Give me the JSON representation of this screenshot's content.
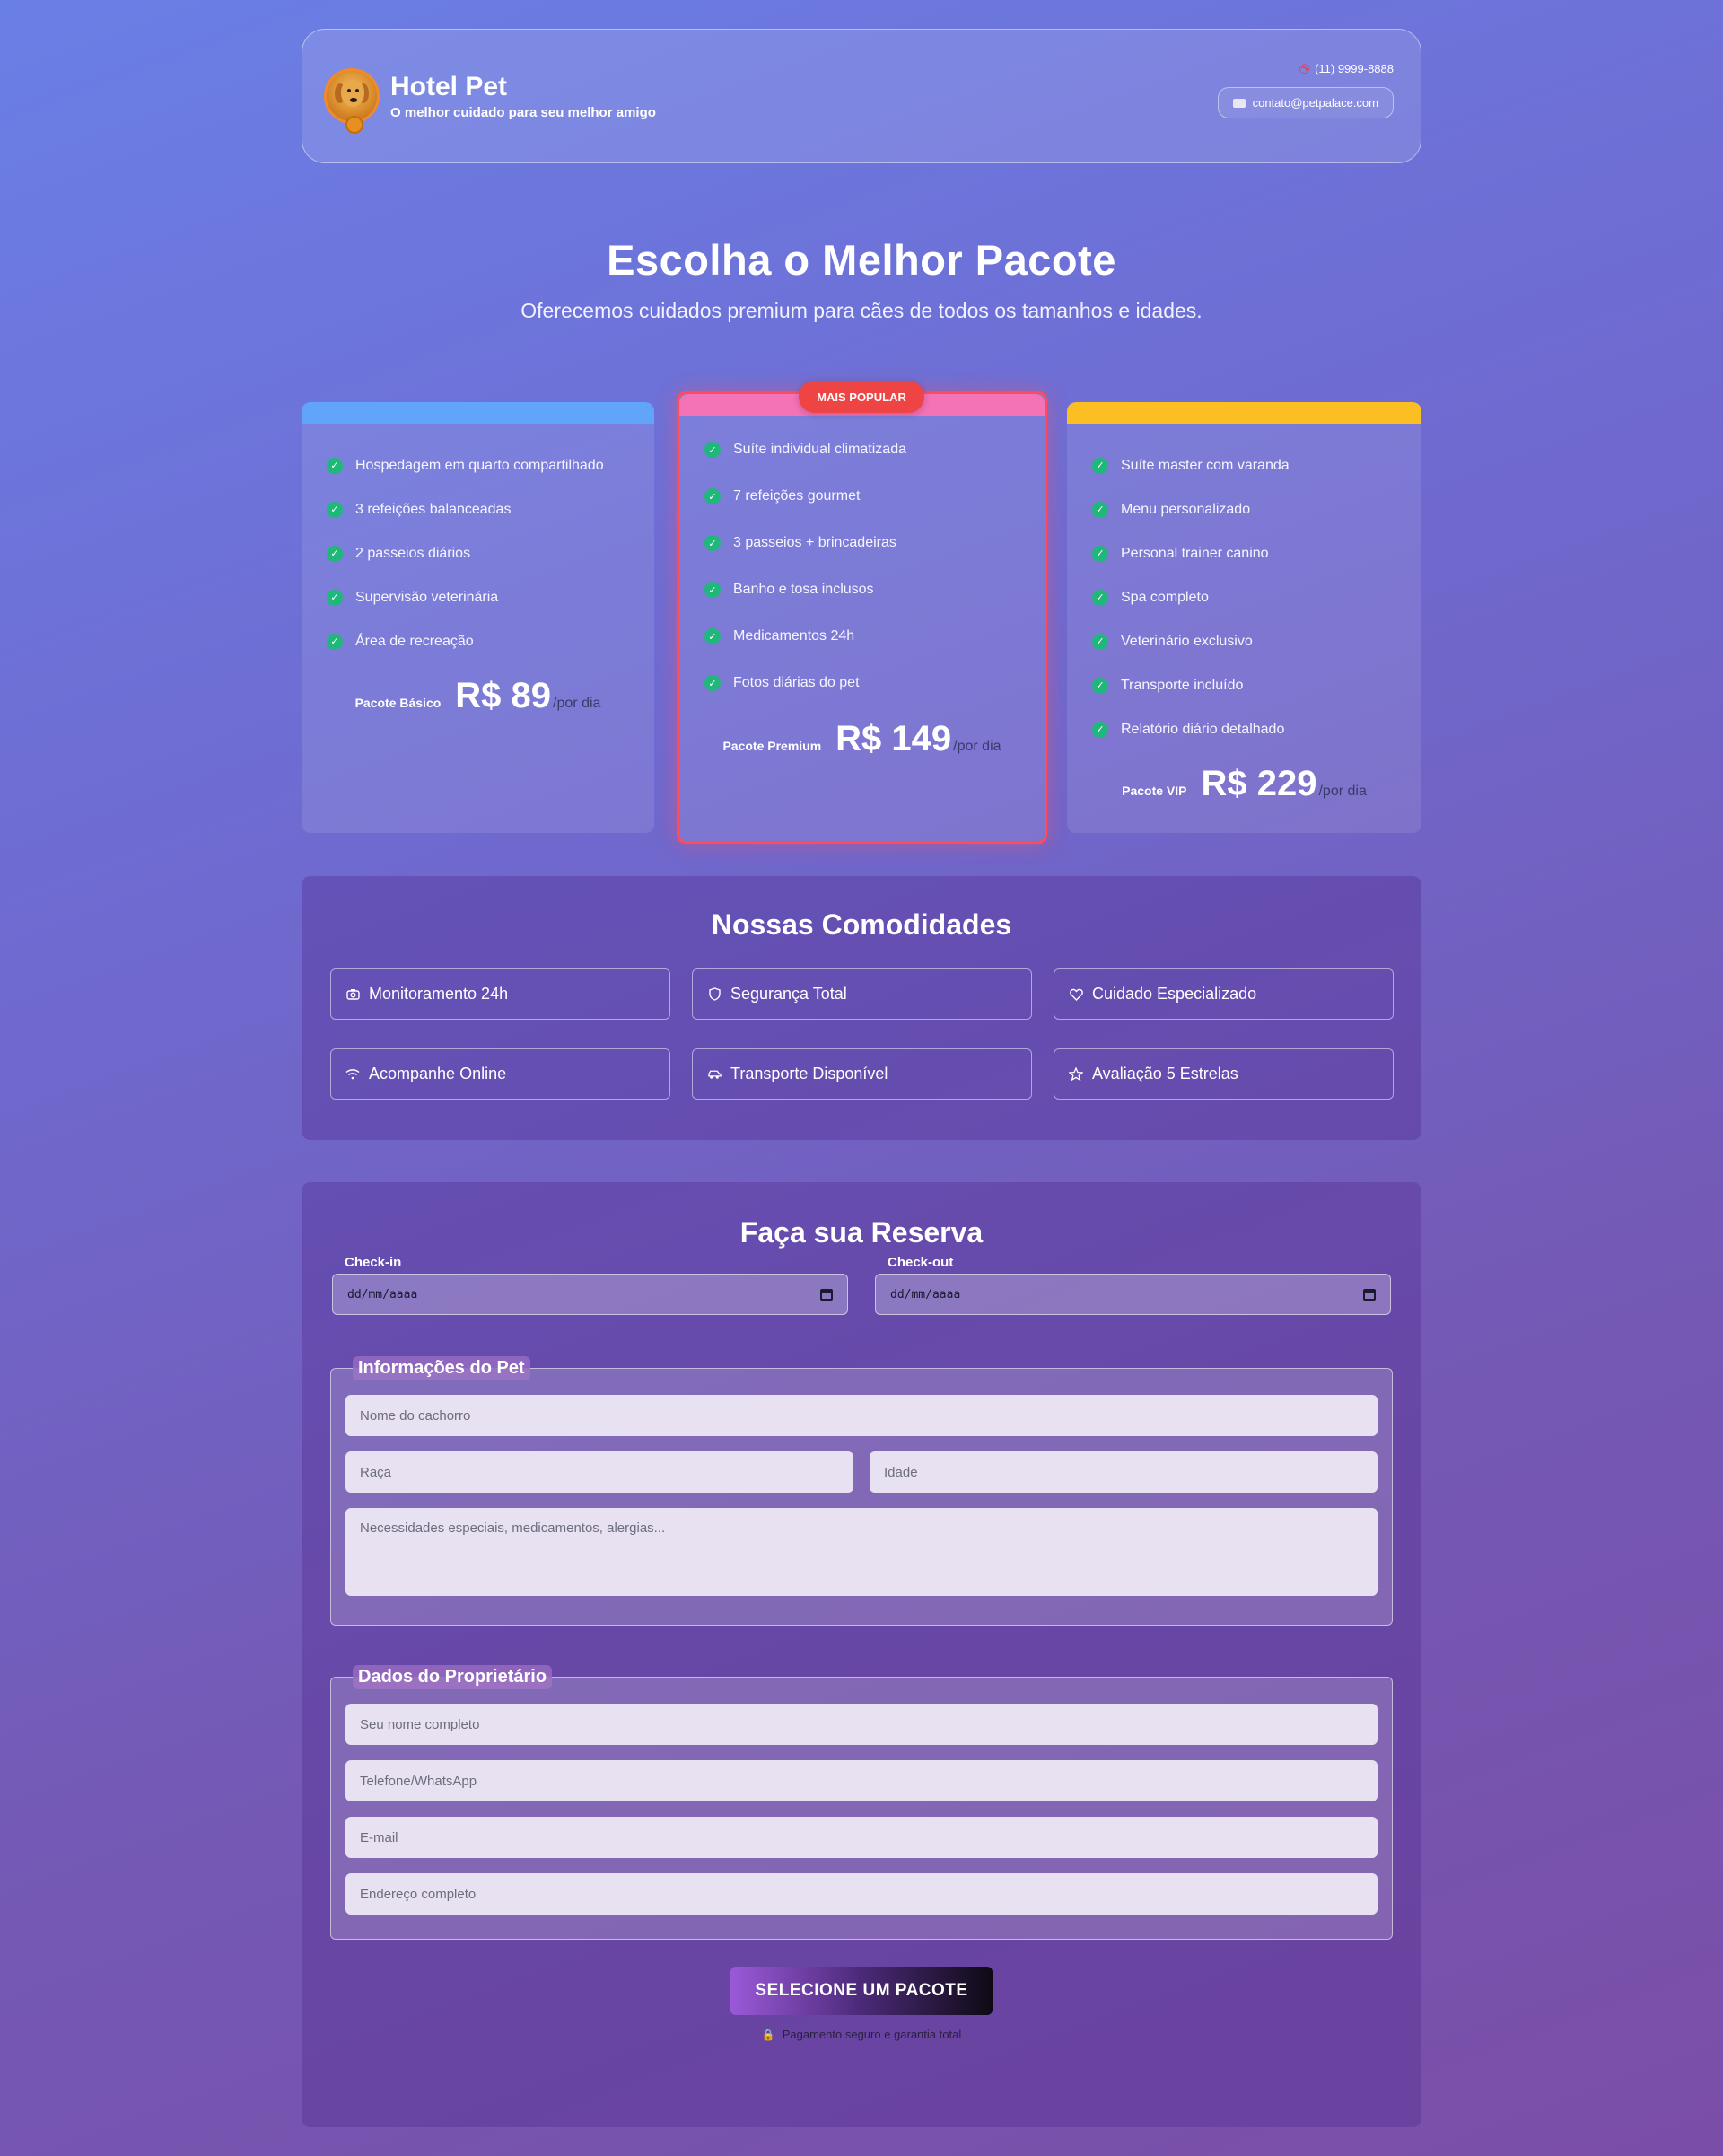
{
  "header": {
    "title": "Hotel Pet",
    "tagline": "O melhor cuidado para seu melhor amigo",
    "phone": "(11) 9999-8888",
    "email": "contato@petpalace.com"
  },
  "hero": {
    "title": "Escolha o Melhor Pacote",
    "subtitle": "Oferecemos cuidados premium para cães de todos os tamanhos e idades."
  },
  "packages": [
    {
      "name": "Pacote Básico",
      "price": "R$ 89",
      "unit": "/por dia",
      "accent": "#60a5fa",
      "features": [
        "Hospedagem em quarto compartilhado",
        "3 refeições balanceadas",
        "2 passeios diários",
        "Supervisão veterinária",
        "Área de recreação"
      ]
    },
    {
      "name": "Pacote Premium",
      "price": "R$ 149",
      "unit": "/por dia",
      "accent": "#f472b6",
      "badge": "MAIS POPULAR",
      "features": [
        "Suíte individual climatizada",
        "7 refeições gourmet",
        "3 passeios + brincadeiras",
        "Banho e tosa inclusos",
        "Medicamentos 24h",
        "Fotos diárias do pet"
      ]
    },
    {
      "name": "Pacote VIP",
      "price": "R$ 229",
      "unit": "/por dia",
      "accent": "#fbbf24",
      "features": [
        "Suíte master com varanda",
        "Menu personalizado",
        "Personal trainer canino",
        "Spa completo",
        "Veterinário exclusivo",
        "Transporte incluído",
        "Relatório diário detalhado"
      ]
    }
  ],
  "amenities": {
    "title": "Nossas Comodidades",
    "items": [
      {
        "label": "Monitoramento 24h",
        "icon": "camera-icon"
      },
      {
        "label": "Segurança Total",
        "icon": "shield-icon"
      },
      {
        "label": "Cuidado Especializado",
        "icon": "heart-icon"
      },
      {
        "label": "Acompanhe Online",
        "icon": "wifi-icon"
      },
      {
        "label": "Transporte Disponível",
        "icon": "car-icon"
      },
      {
        "label": "Avaliação 5 Estrelas",
        "icon": "star-icon"
      }
    ]
  },
  "booking": {
    "title": "Faça sua Reserva",
    "checkin_label": "Check-in",
    "checkout_label": "Check-out",
    "date_placeholder": "dd/mm/aaaa",
    "pet_legend": "Informações do Pet",
    "pet_name_placeholder": "Nome do cachorro",
    "breed_placeholder": "Raça",
    "age_placeholder": "Idade",
    "needs_placeholder": "Necessidades especiais, medicamentos, alergias...",
    "owner_legend": "Dados do Proprietário",
    "owner_name_placeholder": "Seu nome completo",
    "phone_placeholder": "Telefone/WhatsApp",
    "email_placeholder": "E-mail",
    "address_placeholder": "Endereço completo",
    "submit_label": "SELECIONE UM PACOTE",
    "secure_note": "Pagamento seguro e garantia total"
  }
}
